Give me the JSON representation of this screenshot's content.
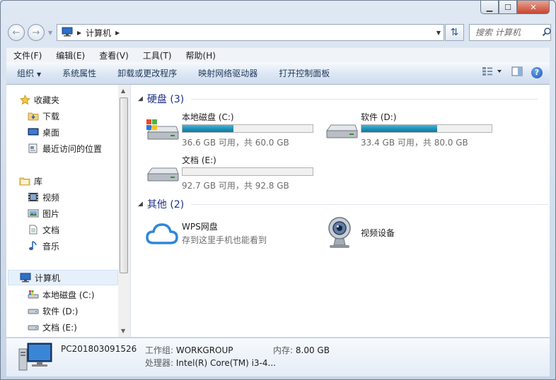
{
  "window": {
    "caption_buttons": {
      "minimize": "▁",
      "maximize": "☐",
      "close": "✕"
    }
  },
  "address_bar": {
    "crumbs": [
      "计算机"
    ],
    "search_placeholder": "搜索 计算机"
  },
  "menu": [
    "文件(F)",
    "编辑(E)",
    "查看(V)",
    "工具(T)",
    "帮助(H)"
  ],
  "commands": [
    "组织",
    "系统属性",
    "卸载或更改程序",
    "映射网络驱动器",
    "打开控制面板"
  ],
  "nav": {
    "favorites": {
      "label": "收藏夹",
      "items": [
        "下载",
        "桌面",
        "最近访问的位置"
      ]
    },
    "libraries": {
      "label": "库",
      "items": [
        "视频",
        "图片",
        "文档",
        "音乐"
      ]
    },
    "computer": {
      "label": "计算机",
      "items": [
        "本地磁盘 (C:)",
        "软件 (D:)",
        "文档 (E:)"
      ]
    }
  },
  "groups": {
    "hard_disks": "硬盘 (3)",
    "others": "其他 (2)"
  },
  "drives": [
    {
      "name": "本地磁盘 (C:)",
      "free": "36.6 GB 可用，共 60.0 GB",
      "used_fraction": 0.39
    },
    {
      "name": "软件 (D:)",
      "free": "33.4 GB 可用，共 80.0 GB",
      "used_fraction": 0.58
    },
    {
      "name": "文档 (E:)",
      "free": "92.7 GB 可用，共 92.8 GB",
      "used_fraction": 0.001
    }
  ],
  "others": [
    {
      "name": "WPS网盘",
      "sub": "存到这里手机也能看到"
    },
    {
      "name": "视频设备",
      "sub": ""
    }
  ],
  "details": {
    "pc_name": "PC201803091526",
    "workgroup_label": "工作组:",
    "workgroup": "WORKGROUP",
    "memory_label": "内存:",
    "memory": "8.00 GB",
    "cpu_label": "处理器:",
    "cpu": "Intel(R) Core(TM) i3-4..."
  },
  "colors": {
    "accent": "#1e3287",
    "drive_fill": "#1f8fb6",
    "command_text": "#1e395b"
  }
}
